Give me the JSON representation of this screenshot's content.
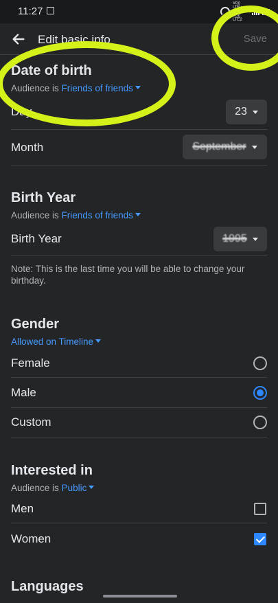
{
  "status_bar": {
    "time": "11:27",
    "volte_label": "Vo)) LTE+ LTE1 Vo)) LTE2"
  },
  "header": {
    "title": "Edit basic info",
    "save_label": "Save"
  },
  "date_of_birth": {
    "title": "Date of birth",
    "audience_prefix": "Audience is",
    "audience_value": "Friends of friends",
    "day_label": "Day",
    "day_value": "23",
    "month_label": "Month",
    "month_value": "September"
  },
  "birth_year": {
    "title": "Birth Year",
    "audience_prefix": "Audience is",
    "audience_value": "Friends of friends",
    "row_label": "Birth Year",
    "year_value": "1995",
    "note": "Note: This is the last time you will be able to change your birthday."
  },
  "gender": {
    "title": "Gender",
    "audience_value": "Allowed on Timeline",
    "options": [
      {
        "label": "Female",
        "selected": false
      },
      {
        "label": "Male",
        "selected": true
      },
      {
        "label": "Custom",
        "selected": false
      }
    ]
  },
  "interested_in": {
    "title": "Interested in",
    "audience_prefix": "Audience is",
    "audience_value": "Public",
    "options": [
      {
        "label": "Men",
        "checked": false
      },
      {
        "label": "Women",
        "checked": true
      }
    ]
  },
  "languages": {
    "title": "Languages"
  },
  "colors": {
    "background": "#242526",
    "accent": "#2d88ff",
    "link": "#4599ff",
    "highlight": "#d4f21a",
    "muted": "#b0b3b8"
  }
}
